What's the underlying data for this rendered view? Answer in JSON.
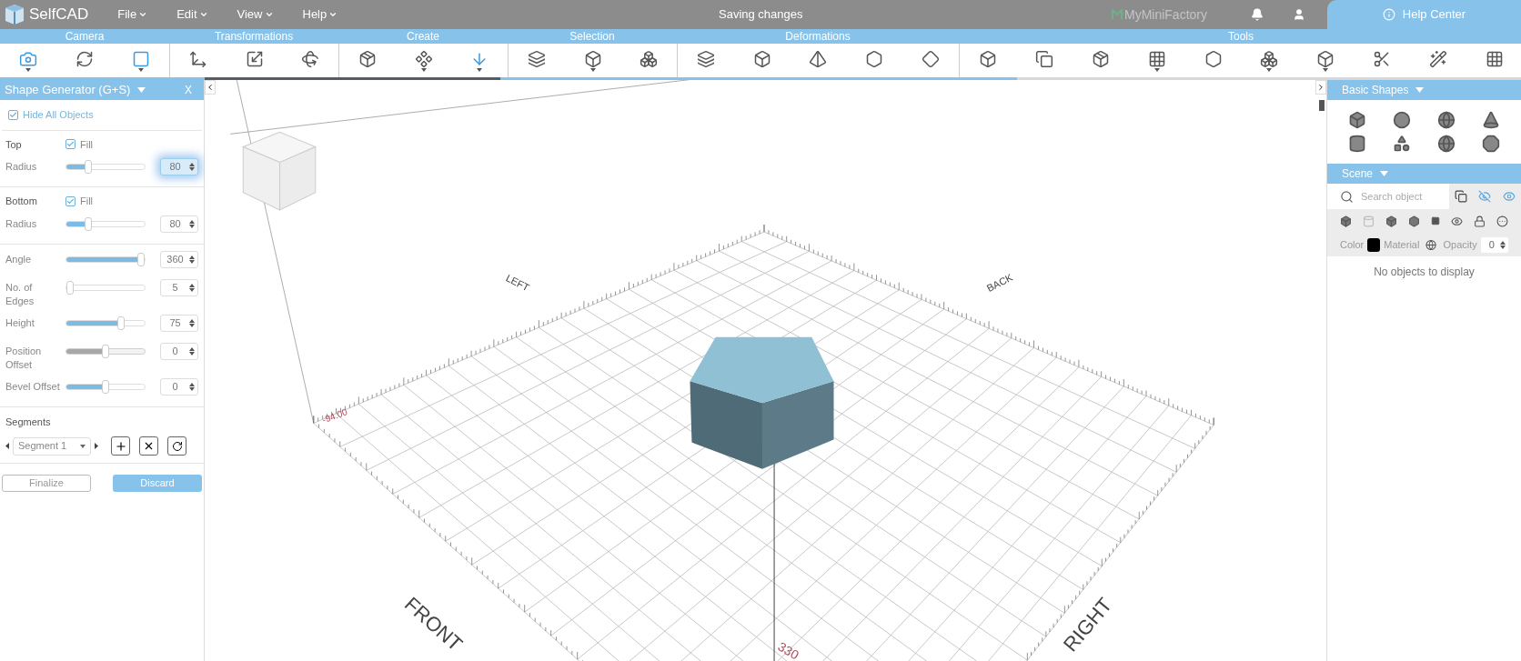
{
  "top_bar": {
    "app_name": "SelfCAD",
    "menus": [
      {
        "label": "File"
      },
      {
        "label": "Edit"
      },
      {
        "label": "View"
      },
      {
        "label": "Help"
      }
    ],
    "status": "Saving changes",
    "partner": "MyMiniFactory",
    "help": "Help Center"
  },
  "toolbar": {
    "groups": [
      {
        "label": "Camera",
        "tools": [
          {
            "selected": true,
            "dropdown": true
          },
          {
            "selected": false,
            "dropdown": false
          },
          {
            "selected": true,
            "dropdown": true
          }
        ]
      },
      {
        "label": "Transformations",
        "tools": [
          {
            "selected": false,
            "dropdown": false
          },
          {
            "selected": false,
            "dropdown": false
          },
          {
            "selected": false,
            "dropdown": false
          }
        ]
      },
      {
        "label": "Create",
        "tools": [
          {
            "selected": false,
            "dropdown": false
          },
          {
            "selected": false,
            "dropdown": true
          },
          {
            "selected": true,
            "dropdown": true
          }
        ]
      },
      {
        "label": "Selection",
        "tools": [
          {
            "selected": false,
            "dropdown": false
          },
          {
            "selected": false,
            "dropdown": true
          },
          {
            "selected": false,
            "dropdown": false
          }
        ]
      },
      {
        "label": "Deformations",
        "tools": [
          {
            "selected": false,
            "dropdown": false
          },
          {
            "selected": false,
            "dropdown": false
          },
          {
            "selected": false,
            "dropdown": false
          },
          {
            "selected": false,
            "dropdown": false
          },
          {
            "selected": false,
            "dropdown": false
          }
        ]
      },
      {
        "label": "Tools",
        "tools": [
          {
            "selected": false,
            "dropdown": false
          },
          {
            "selected": false,
            "dropdown": false
          },
          {
            "selected": false,
            "dropdown": false
          },
          {
            "selected": false,
            "dropdown": true
          },
          {
            "selected": false,
            "dropdown": false
          },
          {
            "selected": false,
            "dropdown": true
          },
          {
            "selected": false,
            "dropdown": true
          },
          {
            "selected": false,
            "dropdown": false
          },
          {
            "selected": false,
            "dropdown": false
          },
          {
            "selected": false,
            "dropdown": false
          }
        ]
      }
    ]
  },
  "shape_panel": {
    "title": "Shape Generator (G+S)",
    "close": "X",
    "hide_all": {
      "label": "Hide All Objects",
      "checked": true
    },
    "groups": [
      {
        "title": "Top",
        "fill": {
          "label": "Fill",
          "checked": true
        },
        "sliders": [
          {
            "label": "Radius",
            "level": 0.25,
            "value": "80",
            "disabled": false,
            "focused": true
          }
        ]
      },
      {
        "title": "Bottom",
        "fill": {
          "label": "Fill",
          "checked": true
        },
        "sliders": [
          {
            "label": "Radius",
            "level": 0.25,
            "value": "80",
            "disabled": false,
            "focused": false
          }
        ]
      },
      {
        "sliders": [
          {
            "label": "Angle",
            "level": 1.0,
            "value": "360",
            "disabled": false,
            "focused": false
          },
          {
            "label": "No. of Edges",
            "level": 0.0,
            "value": "5",
            "disabled": false,
            "focused": false
          },
          {
            "label": "Height",
            "level": 0.72,
            "value": "75",
            "disabled": false,
            "focused": false
          },
          {
            "label": "Position Offset",
            "level": 0.5,
            "value": "0",
            "disabled": true,
            "focused": false
          },
          {
            "label": "Bevel Offset",
            "level": 0.5,
            "value": "0",
            "disabled": false,
            "focused": false
          }
        ]
      }
    ],
    "segments": {
      "title": "Segments",
      "selected_segment": "Segment 1"
    },
    "buttons": [
      {
        "label": "Finalize",
        "kind": "outline"
      },
      {
        "label": "Discard",
        "kind": "primary"
      }
    ]
  },
  "viewport": {
    "axis_labels": [
      "LEFT",
      "BACK",
      "FRONT",
      "RIGHT"
    ],
    "readouts": [
      "-94.00",
      "330"
    ]
  },
  "right_panel": {
    "basic_shapes": {
      "title": "Basic Shapes"
    },
    "scene": {
      "title": "Scene",
      "search_placeholder": "Search object",
      "color_label": "Color",
      "color": "#000000",
      "material_label": "Material",
      "opacity_label": "Opacity",
      "opacity": "0",
      "empty": "No objects to display"
    }
  }
}
